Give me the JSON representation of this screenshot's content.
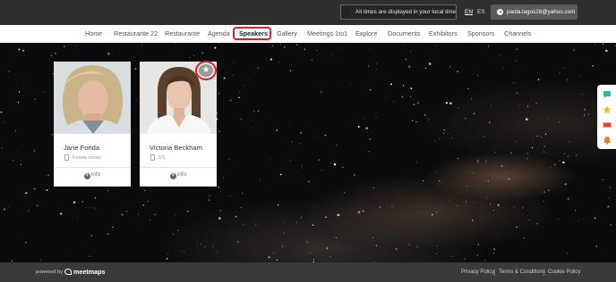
{
  "topbar": {
    "timezone_notice": "All times are displayed in your local time",
    "languages": [
      "EN",
      "ES"
    ],
    "active_language": "EN",
    "user_email": "paola.lagos28@yahoo.com"
  },
  "nav": {
    "items": [
      "Home",
      "Restaurante 22",
      "Restaurante",
      "Agenda",
      "Speakers",
      "Gallery",
      "Meetings 1to1",
      "Explore",
      "Documents",
      "Exhibitors",
      "Sponsors",
      "Channels"
    ],
    "active": "Speakers"
  },
  "speakers": [
    {
      "name": "Jane Fonda",
      "company": "Fonda coorp",
      "info_label": "info",
      "favorite": false
    },
    {
      "name": "Victoria Beckham",
      "company": "VS",
      "info_label": "info",
      "favorite": false
    }
  ],
  "side_toolbar": {
    "icons": [
      "chat-icon",
      "star-icon",
      "ticket-icon",
      "bell-icon"
    ],
    "colors": [
      "#2bb3a3",
      "#f2b61a",
      "#e5412f",
      "#f07c24"
    ]
  },
  "footer": {
    "powered_by": "powered by",
    "brand": "meetmaps",
    "links": [
      "Privacy Policy",
      "Terms & Conditions",
      "Cookie Policy"
    ]
  },
  "colors": {
    "topbar": "#2f2f2f",
    "footer": "#3a3a3a",
    "highlight": "#d9212c"
  }
}
